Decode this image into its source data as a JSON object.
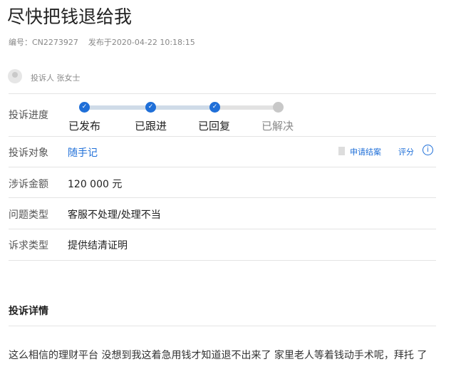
{
  "title": "尽快把钱退给我",
  "meta": {
    "id": "编号：CN2273927",
    "published": "发布于2020-04-22 10:18:15"
  },
  "complainant": "投诉人 张女士",
  "progress": {
    "label": "投诉进度",
    "steps": [
      {
        "label": "已发布",
        "done": true
      },
      {
        "label": "已跟进",
        "done": true
      },
      {
        "label": "已回复",
        "done": true
      },
      {
        "label": "已解决",
        "done": false
      }
    ]
  },
  "target": {
    "label": "投诉对象",
    "value": "随手记",
    "apply": "申请结案",
    "rate": "评分"
  },
  "amount": {
    "label": "涉诉金额",
    "value": "120 000 元"
  },
  "issue": {
    "label": "问题类型",
    "value": "客服不处理/处理不当"
  },
  "demand": {
    "label": "诉求类型",
    "value": "提供结清证明"
  },
  "details": {
    "heading": "投诉详情",
    "text": "这么相信的理财平台 没想到我这着急用钱才知道退不出来了 家里老人等着钱动手术呢，拜托  了"
  },
  "colors": {
    "accent": "#1f6fd8"
  }
}
